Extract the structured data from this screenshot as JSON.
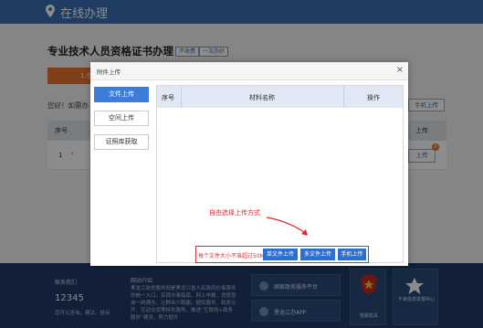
{
  "header": {
    "title": "在线办理",
    "pin_icon": "location-pin-icon"
  },
  "background": {
    "page_title": "专业技术人员资格证书办理",
    "tags": [
      "不收费",
      "一次办好"
    ],
    "tab_label": "1.信",
    "greeting": "您好！如需办",
    "table_header": {
      "seq": "序号",
      "upload": "上传"
    },
    "row": {
      "seq": "1",
      "dots": "*"
    },
    "upload_button": "手机上传",
    "row_upload_button": "上传",
    "badge": "0"
  },
  "footer": {
    "contact_title": "联系我们",
    "phone": "12345",
    "contact_sub": "您可以咨询、建议、投诉",
    "intro_title": "网站介绍",
    "intro_text": "黑龙江政务服务网是黑龙江省人民政府办事服务的统一入口，实现办事指南、网上申报、进度查询一网通办，让群众少跑腿。便民服务、政务公开、互动交流等特色服务，推进“互联网+政务服务”建设，努力提升",
    "links": [
      "国家政务服务平台",
      "黑龙江办APP"
    ],
    "emblem_caption": "党政机关",
    "side_caption": "不良信息举报中心"
  },
  "modal": {
    "title": "附件上传",
    "close": "×",
    "side_buttons": [
      "文件上传",
      "空间上传",
      "证照库获取"
    ],
    "active_index": 0,
    "table_headers": [
      "序号",
      "材料名称",
      "操作"
    ],
    "hint": "自由选择上传方式",
    "note": "每个文件大小不准超过50M",
    "buttons": [
      "单文件上传",
      "多文件上传",
      "手机上传"
    ]
  },
  "colors": {
    "accent": "#3b7dd8",
    "header": "#3a6db2",
    "warning": "#e0262b",
    "orange": "#e7732c"
  }
}
